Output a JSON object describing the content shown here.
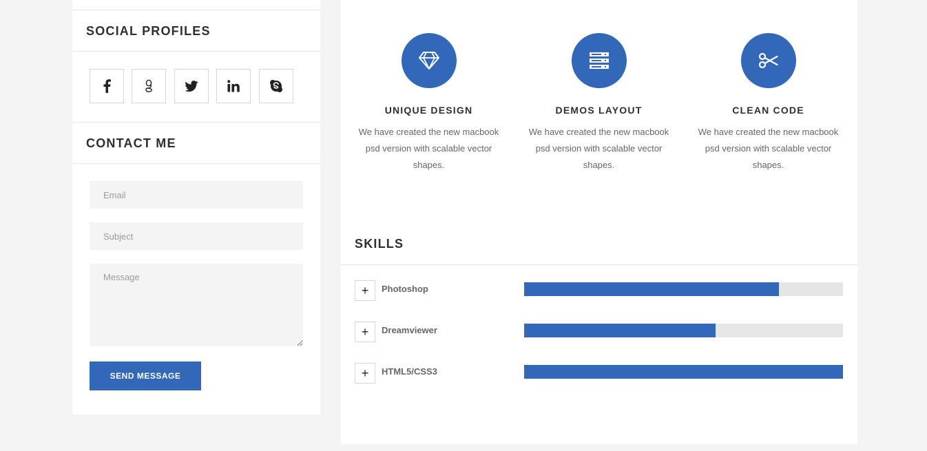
{
  "sidebar": {
    "social_title": "SOCIAL PROFILES",
    "social": [
      {
        "icon": "facebook-icon"
      },
      {
        "icon": "google-icon"
      },
      {
        "icon": "twitter-icon"
      },
      {
        "icon": "linkedin-icon"
      },
      {
        "icon": "skype-icon"
      }
    ],
    "contact_title": "CONTACT ME",
    "email_placeholder": "Email",
    "subject_placeholder": "Subject",
    "message_placeholder": "Message",
    "send_label": "SEND MESSAGE"
  },
  "features": [
    {
      "icon": "diamond-icon",
      "title": "UNIQUE DESIGN",
      "text": "We have created the new macbook psd version with scalable vector shapes."
    },
    {
      "icon": "server-icon",
      "title": "DEMOS LAYOUT",
      "text": "We have created the new macbook psd version with scalable vector shapes."
    },
    {
      "icon": "scissors-icon",
      "title": "CLEAN CODE",
      "text": "We have created the new macbook psd version with scalable vector shapes."
    }
  ],
  "skills": {
    "title": "SKILLS",
    "items": [
      {
        "name": "Photoshop",
        "percent": 80
      },
      {
        "name": "Dreamviewer",
        "percent": 60
      },
      {
        "name": "HTML5/CSS3",
        "percent": 100
      }
    ]
  },
  "colors": {
    "accent": "#3368b9",
    "track": "#e6e6e6",
    "page_bg": "#f4f4f4"
  }
}
